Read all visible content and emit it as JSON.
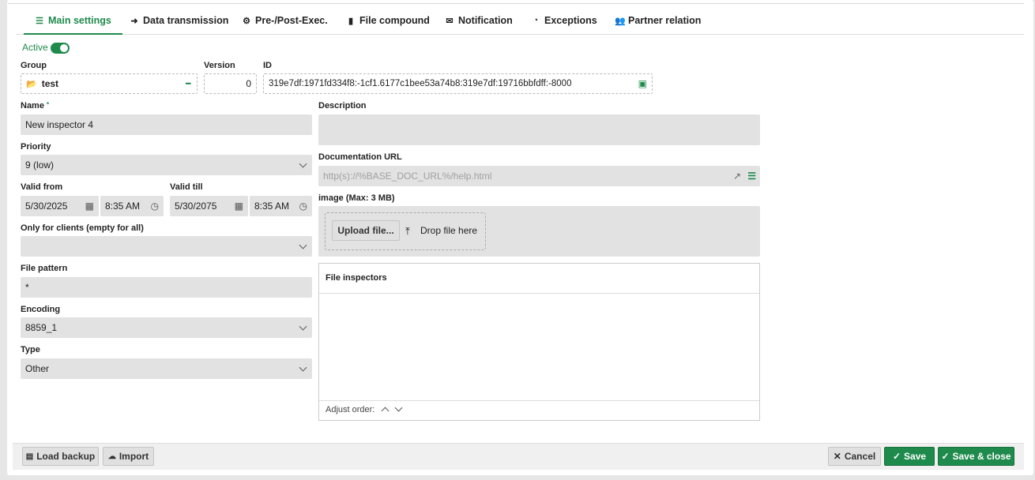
{
  "tabs": [
    {
      "label": "Main settings",
      "icon": "list-icon"
    },
    {
      "label": "Data transmission",
      "icon": "arrow-right-icon"
    },
    {
      "label": "Pre-/Post-Exec.",
      "icon": "gears-icon"
    },
    {
      "label": "File compound",
      "icon": "file-icon"
    },
    {
      "label": "Notification",
      "icon": "envelope-icon"
    },
    {
      "label": "Exceptions",
      "icon": "clock-icon"
    },
    {
      "label": "Partner relation",
      "icon": "users-icon"
    }
  ],
  "active": {
    "label": "Active",
    "value": true
  },
  "group": {
    "label": "Group",
    "value": "test",
    "more": "•••"
  },
  "version": {
    "label": "Version",
    "value": "0"
  },
  "id": {
    "label": "ID",
    "value": "319e7df:1971fd334f8:-1cf1.6177c1bee53a74b8:319e7df:19716bbfdff:-8000"
  },
  "name": {
    "label": "Name",
    "required": "*",
    "value": "New inspector 4"
  },
  "priority": {
    "label": "Priority",
    "value": "9 (low)"
  },
  "valid_from": {
    "label": "Valid from",
    "date": "5/30/2025",
    "time": "8:35 AM"
  },
  "valid_till": {
    "label": "Valid till",
    "date": "5/30/2075",
    "time": "8:35 AM"
  },
  "clients": {
    "label": "Only for clients (empty for all)",
    "value": ""
  },
  "file_pattern": {
    "label": "File pattern",
    "value": "*"
  },
  "encoding": {
    "label": "Encoding",
    "value": "8859_1"
  },
  "type": {
    "label": "Type",
    "value": "Other"
  },
  "description": {
    "label": "Description",
    "value": ""
  },
  "doc_url": {
    "label": "Documentation URL",
    "placeholder": "http(s)://%BASE_DOC_URL%/help.html"
  },
  "image": {
    "label": "image (Max: 3 MB)",
    "upload": "Upload file...",
    "drop": "Drop file here"
  },
  "file_inspectors": {
    "title": "File inspectors",
    "adjust": "Adjust order:"
  },
  "footer": {
    "load_backup": "Load backup",
    "import": "Import",
    "cancel": "Cancel",
    "save": "Save",
    "save_close": "Save & close"
  },
  "colors": {
    "accent": "#1e8a4c",
    "field_bg": "#e2e2e2"
  }
}
